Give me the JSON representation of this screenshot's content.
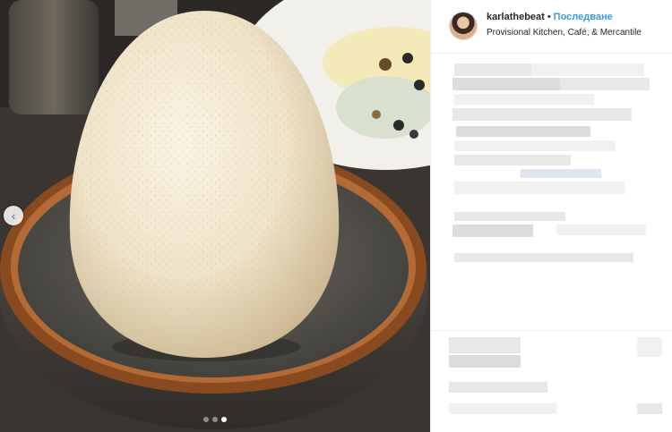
{
  "post": {
    "username": "karlathebeat",
    "separator": "•",
    "follow_label": "Последване",
    "location": "Provisional Kitchen, Café, & Mercantile"
  },
  "carousel": {
    "total_slides": 3,
    "active_slide": 3,
    "prev_icon": "chevron-left-icon"
  },
  "colors": {
    "follow_blue": "#3897f0",
    "text": "#262626",
    "bowl_rim": "#8a4a1f",
    "egg": "#efe5cf"
  }
}
